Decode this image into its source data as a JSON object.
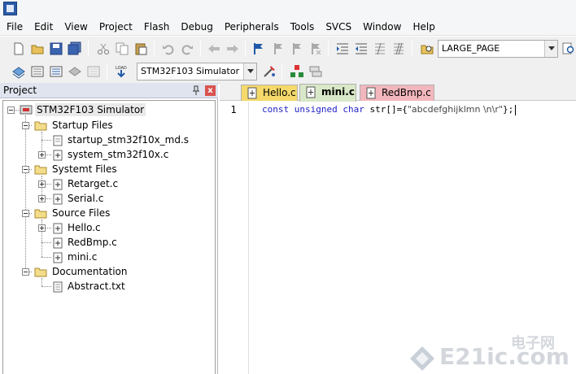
{
  "menu": [
    "File",
    "Edit",
    "View",
    "Project",
    "Flash",
    "Debug",
    "Peripherals",
    "Tools",
    "SVCS",
    "Window",
    "Help"
  ],
  "toolbar": {
    "page_combo": "LARGE_PAGE",
    "target_combo": "STM32F103 Simulator"
  },
  "project_panel": {
    "title": "Project",
    "close_label": "x",
    "tree": {
      "root": "STM32F103 Simulator",
      "groups": [
        {
          "name": "Startup Files",
          "files": [
            "startup_stm32f10x_md.s",
            "system_stm32f10x.c"
          ]
        },
        {
          "name": "Systemt Files",
          "files": [
            "Retarget.c",
            "Serial.c"
          ]
        },
        {
          "name": "Source Files",
          "files": [
            "Hello.c",
            "RedBmp.c",
            "mini.c"
          ]
        },
        {
          "name": "Documentation",
          "files": [
            "Abstract.txt"
          ]
        }
      ]
    }
  },
  "editor": {
    "tabs": [
      {
        "label": "Hello.c",
        "color": "#f5d96b"
      },
      {
        "label": "mini.c",
        "color": "#d9e8c8"
      },
      {
        "label": "RedBmp.c",
        "color": "#f2b7bd"
      }
    ],
    "active_tab": "mini.c",
    "line_number": "1",
    "code": {
      "kw1": "const",
      "kw2": "unsigned",
      "kw3": "char",
      "ident": "str[]={",
      "string": "\"abcdefghijklmn \\n\\r\"",
      "tail": "};"
    }
  },
  "watermark": {
    "cn": "电子网",
    "en": "E21ic.com"
  },
  "colors": {
    "keyword": "#1f1fc4",
    "panel_header": "#dfe4ee"
  }
}
